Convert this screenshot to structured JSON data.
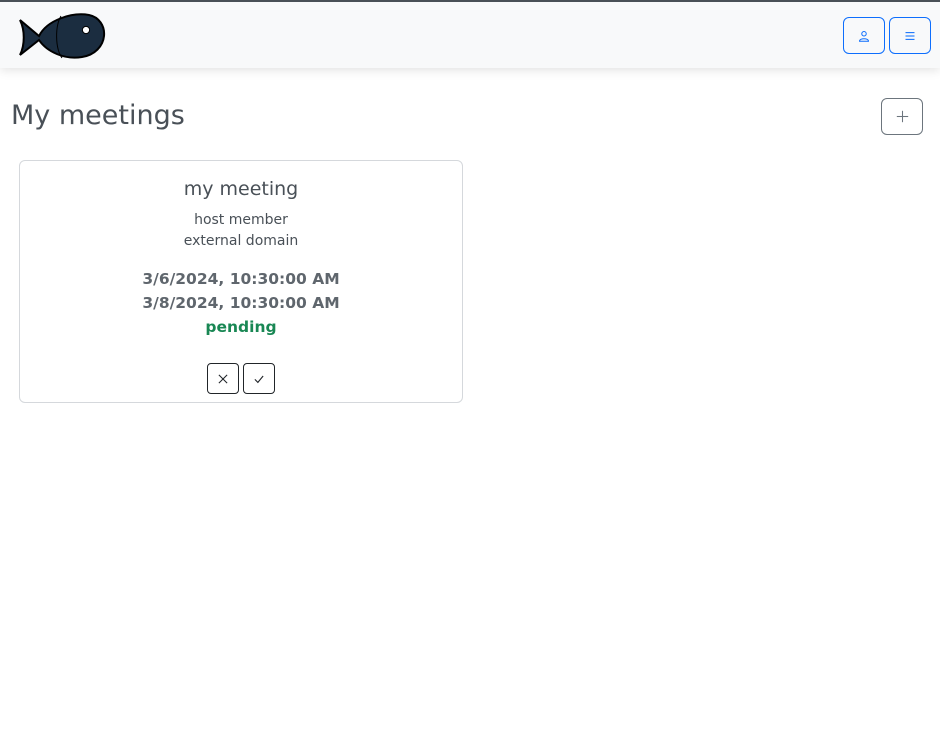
{
  "header": {
    "logo_icon": "fish-icon",
    "user_button_icon": "person-icon",
    "menu_button_icon": "hamburger-menu-icon",
    "accent_color": "#0d6efd"
  },
  "main": {
    "title": "My meetings",
    "add_button_icon": "plus-icon"
  },
  "meetings": [
    {
      "title": "my meeting",
      "host": "host member",
      "domain": "external domain",
      "start": "3/6/2024, 10:30:00 AM",
      "end": "3/8/2024, 10:30:00 AM",
      "status": "pending",
      "status_color": "#198754",
      "actions": [
        "close-icon",
        "check-icon"
      ]
    }
  ]
}
